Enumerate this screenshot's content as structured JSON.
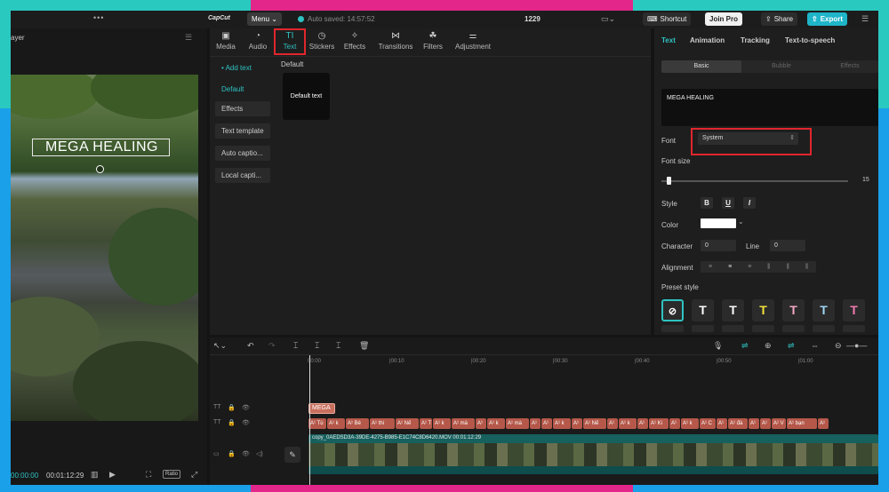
{
  "titlebar": {
    "dots": "•••",
    "logo": "CapCut",
    "menu_label": "Menu",
    "autosave": "Auto saved: 14:57:52",
    "project_title": "1229",
    "shortcut_label": "Shortcut",
    "join_pro_label": "Join Pro",
    "share_label": "Share",
    "export_label": "Export"
  },
  "player": {
    "title": "ayer",
    "overlay_text": "MEGA HEALING",
    "current_time": "00:00:00",
    "duration": "00:01:12:29",
    "ratio_label": "Ratio"
  },
  "media": {
    "tabs": [
      {
        "label": "Media",
        "icon": "▣"
      },
      {
        "label": "Audio",
        "icon": "◔"
      },
      {
        "label": "Text",
        "icon": "TI"
      },
      {
        "label": "Stickers",
        "icon": "◷"
      },
      {
        "label": "Effects",
        "icon": "✧"
      },
      {
        "label": "Transitions",
        "icon": "⋈"
      },
      {
        "label": "Filters",
        "icon": "☘"
      },
      {
        "label": "Adjustment",
        "icon": "⚌"
      }
    ],
    "sidenav": [
      "• Add text",
      "Default",
      "Effects",
      "Text template",
      "Auto captio...",
      "Local capti..."
    ],
    "section_label": "Default",
    "card_label": "Default text"
  },
  "props": {
    "tabs": [
      "Text",
      "Animation",
      "Tracking",
      "Text-to-speech"
    ],
    "subtabs": [
      "Basic",
      "Bubble",
      "Effects"
    ],
    "text_value": "MEGA HEALING",
    "font_label": "Font",
    "font_value": "System",
    "font_size_label": "Font size",
    "font_size_value": "15",
    "font_size_fraction": 0.03,
    "style_label": "Style",
    "style_buttons": [
      "B",
      "U",
      "I"
    ],
    "color_label": "Color",
    "color_value": "#ffffff",
    "character_label": "Character",
    "character_value": "0",
    "line_label": "Line",
    "line_value": "0",
    "alignment_label": "Alignment",
    "preset_label": "Preset style",
    "presets": [
      {
        "glyph": "⃠",
        "color": "#ffffff"
      },
      {
        "glyph": "T",
        "color": "#ffffff"
      },
      {
        "glyph": "T",
        "color": "#ffffff"
      },
      {
        "glyph": "T",
        "color": "#f3e33a"
      },
      {
        "glyph": "T",
        "color": "#f4a8c8"
      },
      {
        "glyph": "T",
        "color": "#9fd7f5"
      },
      {
        "glyph": "T",
        "color": "#f47ab0"
      }
    ]
  },
  "timeline": {
    "ruler": [
      "00:00",
      "|00:10",
      "|00:20",
      "|00:30",
      "|00:40",
      "|00:50",
      "|01:00"
    ],
    "mega_clip": "MEGA",
    "subtitle_clips": [
      "A¹ Tù",
      "A¹ k",
      "A¹ Bé",
      "A¹ thi",
      "A¹ Nế",
      "A¹ T",
      "A¹ k",
      "A¹ mà",
      "A¹",
      "A¹ k",
      "A¹ mà",
      "A¹",
      "A¹",
      "A¹ k",
      "A¹",
      "A¹ Nế",
      "A¹",
      "A¹ k",
      "A¹",
      "A¹ Ki",
      "A¹",
      "A¹ k",
      "A¹ C",
      "A¹",
      "A¹ đà",
      "A¹",
      "A¹",
      "A¹ V",
      "A¹ bạn",
      "A¹"
    ],
    "video_label": "copy_0AEDSD3A-39DE-4275-B985-E1C74C8D6420.MOV   00:01:12:29"
  }
}
